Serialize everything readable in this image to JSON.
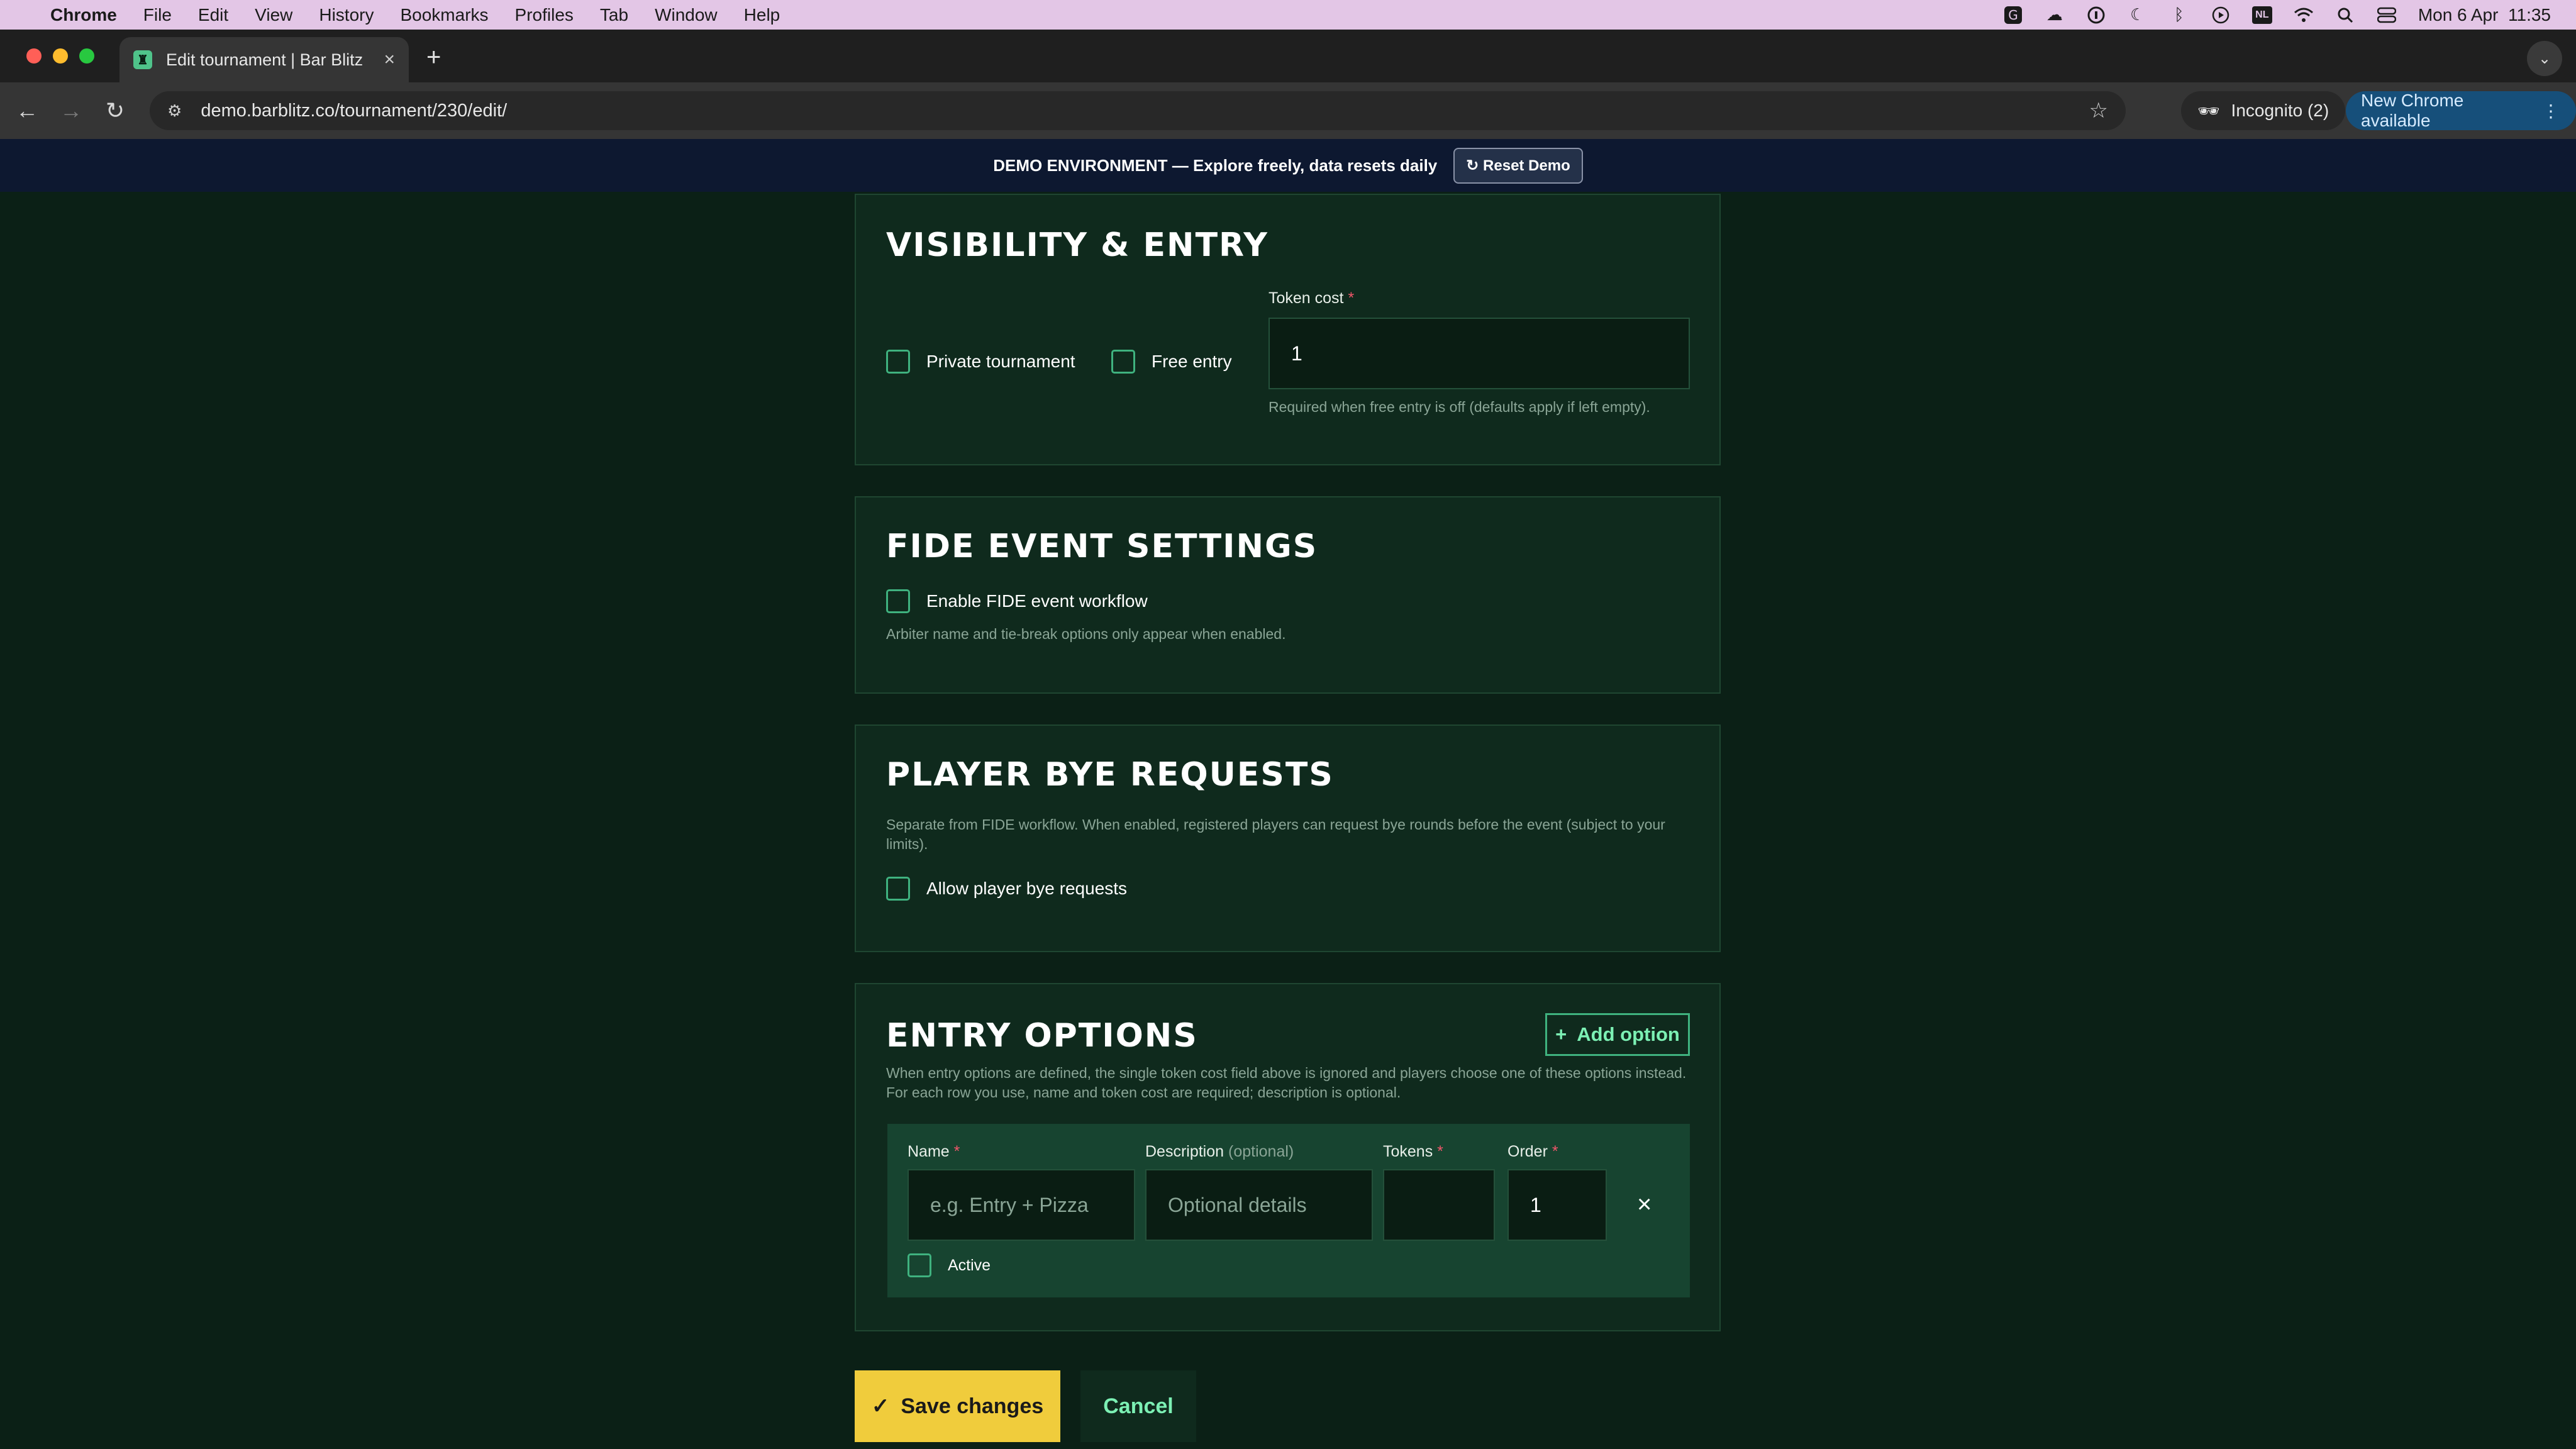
{
  "menubar": {
    "app": "Chrome",
    "items": [
      "File",
      "Edit",
      "View",
      "History",
      "Bookmarks",
      "Profiles",
      "Tab",
      "Window",
      "Help"
    ],
    "status_icons": [
      "grammarly-icon",
      "cloud-icon",
      "onepassword-icon",
      "moon-icon",
      "bluetooth-icon",
      "play-icon",
      "nl-icon",
      "wifi-icon",
      "spotlight-icon",
      "control-center-icon"
    ],
    "nl_label": "NL",
    "clock": "Mon 6 Apr  11:35"
  },
  "browser": {
    "tab_title": "Edit tournament | Bar Blitz",
    "url": "demo.barblitz.co/tournament/230/edit/",
    "incognito_label": "Incognito (2)",
    "update_label": "New Chrome available"
  },
  "demo_banner": {
    "text": "DEMO ENVIRONMENT — Explore freely, data resets daily",
    "reset_label": "↻ Reset Demo"
  },
  "visibility": {
    "title": "VISIBILITY & ENTRY",
    "private_label": "Private tournament",
    "free_entry_label": "Free entry",
    "token_cost_label": "Token cost",
    "required_mark": "*",
    "token_cost_value": "1",
    "token_cost_help": "Required when free entry is off (defaults apply if left empty)."
  },
  "fide": {
    "title": "FIDE EVENT SETTINGS",
    "enable_label": "Enable FIDE event workflow",
    "help": "Arbiter name and tie-break options only appear when enabled."
  },
  "bye": {
    "title": "PLAYER BYE REQUESTS",
    "help": "Separate from FIDE workflow. When enabled, registered players can request bye rounds before the event (subject to your limits).",
    "allow_label": "Allow player bye requests"
  },
  "entry_options": {
    "title": "ENTRY OPTIONS",
    "add_label": "Add option",
    "help_line1": "When entry options are defined, the single token cost field above is ignored and players choose one of these options instead.",
    "help_line2": "For each row you use, name and token cost are required; description is optional.",
    "name_label": "Name",
    "description_label": "Description",
    "optional_label": "(optional)",
    "tokens_label": "Tokens",
    "order_label": "Order",
    "name_placeholder": "e.g. Entry + Pizza",
    "description_placeholder": "Optional details",
    "tokens_value": "",
    "order_value": "1",
    "active_label": "Active"
  },
  "actions": {
    "save_label": "Save changes",
    "cancel_label": "Cancel"
  },
  "colors": {
    "accent_green": "#3fb27f",
    "save_yellow": "#f0cc3c",
    "page_bg": "#0b2016",
    "card_bg": "#0f2a1d"
  }
}
